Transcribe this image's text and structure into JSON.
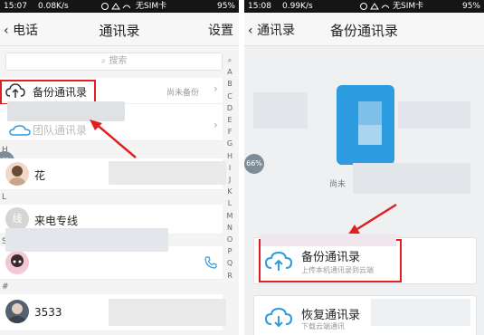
{
  "left": {
    "status": {
      "time": "15:07",
      "speed": "0.08K/s",
      "carrier": "无SIM卡",
      "battery": "95%"
    },
    "nav": {
      "back_label": "电话",
      "title": "通讯录",
      "settings_label": "设置"
    },
    "search_placeholder": "搜索",
    "backup_row": {
      "label": "备份通讯录",
      "status": "尚未备份"
    },
    "team_row": {
      "label": "团队通讯录"
    },
    "sections": {
      "h": "H",
      "l": "L",
      "s": "S",
      "hash": "#"
    },
    "contacts": [
      {
        "name": "花"
      },
      {
        "name": "来电专线",
        "avatar_text": "线"
      },
      {
        "name": ""
      },
      {
        "name": "3533"
      }
    ],
    "progress_badge": "66%",
    "index_letters": [
      "A",
      "B",
      "C",
      "D",
      "E",
      "F",
      "G",
      "H",
      "I",
      "J",
      "K",
      "L",
      "M",
      "N",
      "O",
      "P",
      "Q",
      "R"
    ]
  },
  "right": {
    "status": {
      "time": "15:08",
      "speed": "0.99K/s",
      "carrier": "无SIM卡",
      "battery": "95%"
    },
    "nav": {
      "back_label": "通讯录",
      "title": "备份通讯录"
    },
    "partial_text": "尚未",
    "progress_badge": "66%",
    "backup_card": {
      "title": "备份通讯录",
      "subtitle": "上传本机通讯录到云端"
    },
    "restore_card": {
      "title": "恢复通讯录",
      "subtitle": "下载云端通讯"
    }
  },
  "colors": {
    "accent": "#2f8fd8",
    "highlight": "#e02020",
    "contact_blue": "#2c9be0"
  }
}
